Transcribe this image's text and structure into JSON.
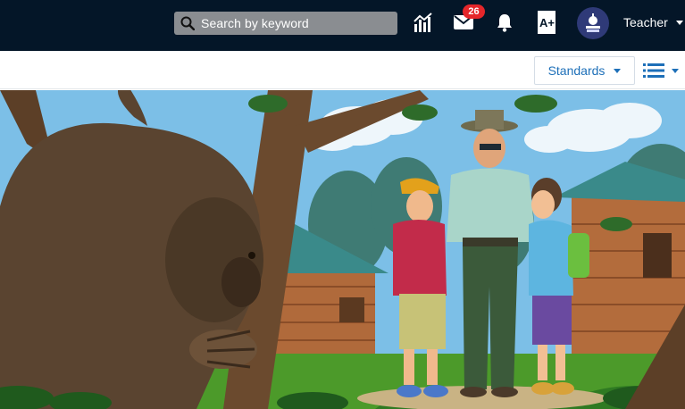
{
  "topbar": {
    "search": {
      "placeholder": "Search by keyword",
      "icon": "search-icon"
    },
    "icons": [
      "chart-icon",
      "mail-icon",
      "bell-icon",
      "grade-a-plus-icon"
    ],
    "mail_badge_count": "26",
    "user": {
      "label": "Teacher",
      "avatar_icon": "apple-books-icon"
    }
  },
  "toolbar": {
    "standards_label": "Standards",
    "view_icon": "list-view-icon"
  },
  "hero": {
    "image_icon": "illustration",
    "colors": {
      "sky": "#7cbfe7",
      "grass": "#4c9a2a",
      "cabin": "#b06a3b",
      "roof": "#3a8a8a"
    }
  }
}
